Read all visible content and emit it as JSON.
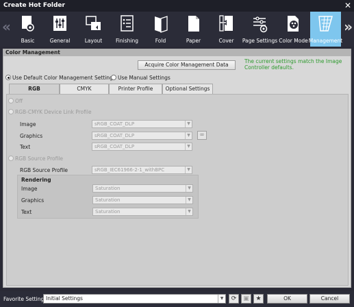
{
  "window": {
    "title": "Create Hot Folder"
  },
  "toolbar": {
    "items": [
      {
        "label": "Basic",
        "icon": "basic-icon"
      },
      {
        "label": "General",
        "icon": "general-icon"
      },
      {
        "label": "Layout",
        "icon": "layout-icon"
      },
      {
        "label": "Finishing",
        "icon": "finishing-icon"
      },
      {
        "label": "Fold",
        "icon": "fold-icon"
      },
      {
        "label": "Paper",
        "icon": "paper-icon"
      },
      {
        "label": "Cover",
        "icon": "cover-icon"
      },
      {
        "label": "Page Settings",
        "icon": "page-settings-icon"
      },
      {
        "label": "Color Mode",
        "icon": "color-mode-icon"
      },
      {
        "label": "Management",
        "icon": "management-icon"
      }
    ],
    "active_index": 9,
    "active_color": "#7ec6ee"
  },
  "section": {
    "title": "Color Management"
  },
  "acquire_button": "Acquire Color Management Data",
  "status_message": "The current settings match the Image Controller defaults.",
  "status_color": "#2d9a2d",
  "mode": {
    "default_label": "Use Default Color Management Settings",
    "manual_label": "Use Manual Settings"
  },
  "tabs": [
    "RGB",
    "CMYK",
    "Printer Profile",
    "Optional Settings"
  ],
  "rgb": {
    "off_label": "Off",
    "device_link_label": "RGB-CMYK Device Link Profile",
    "device_link_rows": [
      {
        "label": "Image",
        "value": "sRGB_COAT_DLP"
      },
      {
        "label": "Graphics",
        "value": "sRGB_COAT_DLP"
      },
      {
        "label": "Text",
        "value": "sRGB_COAT_DLP"
      }
    ],
    "source_profile_option": "RGB Source Profile",
    "source_profile_label": "RGB Source Profile",
    "source_profile_value": "sRGB_IEC61966-2-1_withBPC",
    "rendering_title": "Rendering",
    "rendering_rows": [
      {
        "label": "Image",
        "value": "Saturation"
      },
      {
        "label": "Graphics",
        "value": "Saturation"
      },
      {
        "label": "Text",
        "value": "Saturation"
      }
    ]
  },
  "footer": {
    "favorite_label": "Favorite Setting",
    "favorite_value": "Initial Settings",
    "ok": "OK",
    "cancel": "Cancel"
  }
}
